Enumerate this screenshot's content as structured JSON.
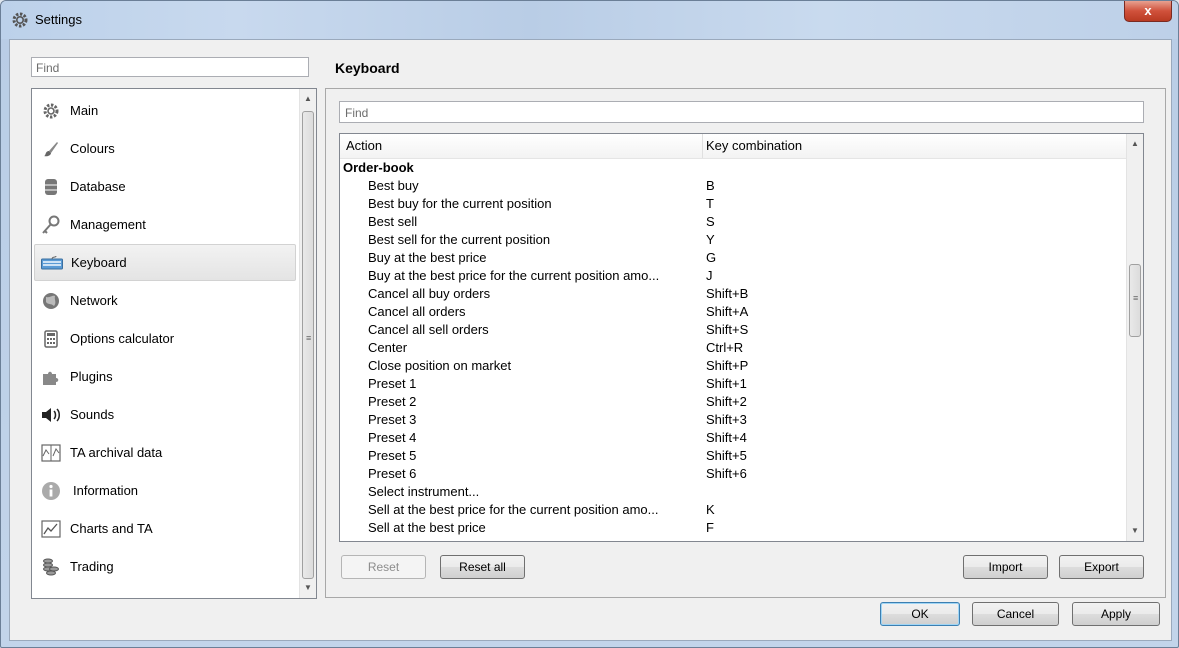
{
  "window": {
    "title": "Settings",
    "close_label": "x"
  },
  "left_search": {
    "placeholder": "Find"
  },
  "sidebar": {
    "items": [
      {
        "label": "Main",
        "icon": "gear-icon"
      },
      {
        "label": "Colours",
        "icon": "brush-icon"
      },
      {
        "label": "Database",
        "icon": "database-icon"
      },
      {
        "label": "Management",
        "icon": "key-icon"
      },
      {
        "label": "Keyboard",
        "icon": "keyboard-icon",
        "selected": true
      },
      {
        "label": "Network",
        "icon": "globe-icon"
      },
      {
        "label": "Options calculator",
        "icon": "calculator-icon"
      },
      {
        "label": "Plugins",
        "icon": "puzzle-icon"
      },
      {
        "label": "Sounds",
        "icon": "speaker-icon"
      },
      {
        "label": "TA archival data",
        "icon": "archive-chart-icon"
      },
      {
        "label": "Information",
        "icon": "info-icon"
      },
      {
        "label": "Charts and TA",
        "icon": "chart-icon"
      },
      {
        "label": "Trading",
        "icon": "coins-icon"
      }
    ]
  },
  "page": {
    "title": "Keyboard"
  },
  "inner_search": {
    "placeholder": "Find"
  },
  "table": {
    "columns": [
      "Action",
      "Key combination"
    ],
    "group": "Order-book",
    "rows": [
      {
        "action": "Best buy",
        "key": "B"
      },
      {
        "action": "Best buy for the current position",
        "key": "T"
      },
      {
        "action": "Best sell",
        "key": "S"
      },
      {
        "action": "Best sell for the current position",
        "key": "Y"
      },
      {
        "action": "Buy at the best price",
        "key": "G"
      },
      {
        "action": "Buy at the best price for the current position amo...",
        "key": "J"
      },
      {
        "action": "Cancel all buy orders",
        "key": "Shift+B"
      },
      {
        "action": "Cancel all orders",
        "key": "Shift+A"
      },
      {
        "action": "Cancel all sell orders",
        "key": "Shift+S"
      },
      {
        "action": "Center",
        "key": "Ctrl+R"
      },
      {
        "action": "Close position on market",
        "key": "Shift+P"
      },
      {
        "action": "Preset 1",
        "key": "Shift+1"
      },
      {
        "action": "Preset 2",
        "key": "Shift+2"
      },
      {
        "action": "Preset 3",
        "key": "Shift+3"
      },
      {
        "action": "Preset 4",
        "key": "Shift+4"
      },
      {
        "action": "Preset 5",
        "key": "Shift+5"
      },
      {
        "action": "Preset 6",
        "key": "Shift+6"
      },
      {
        "action": "Select instrument...",
        "key": ""
      },
      {
        "action": "Sell at the best  price for the current position amo...",
        "key": "K"
      },
      {
        "action": "Sell at the best price",
        "key": "F"
      }
    ]
  },
  "buttons": {
    "reset": "Reset",
    "reset_all": "Reset all",
    "import": "Import",
    "export": "Export",
    "ok": "OK",
    "cancel": "Cancel",
    "apply": "Apply"
  }
}
